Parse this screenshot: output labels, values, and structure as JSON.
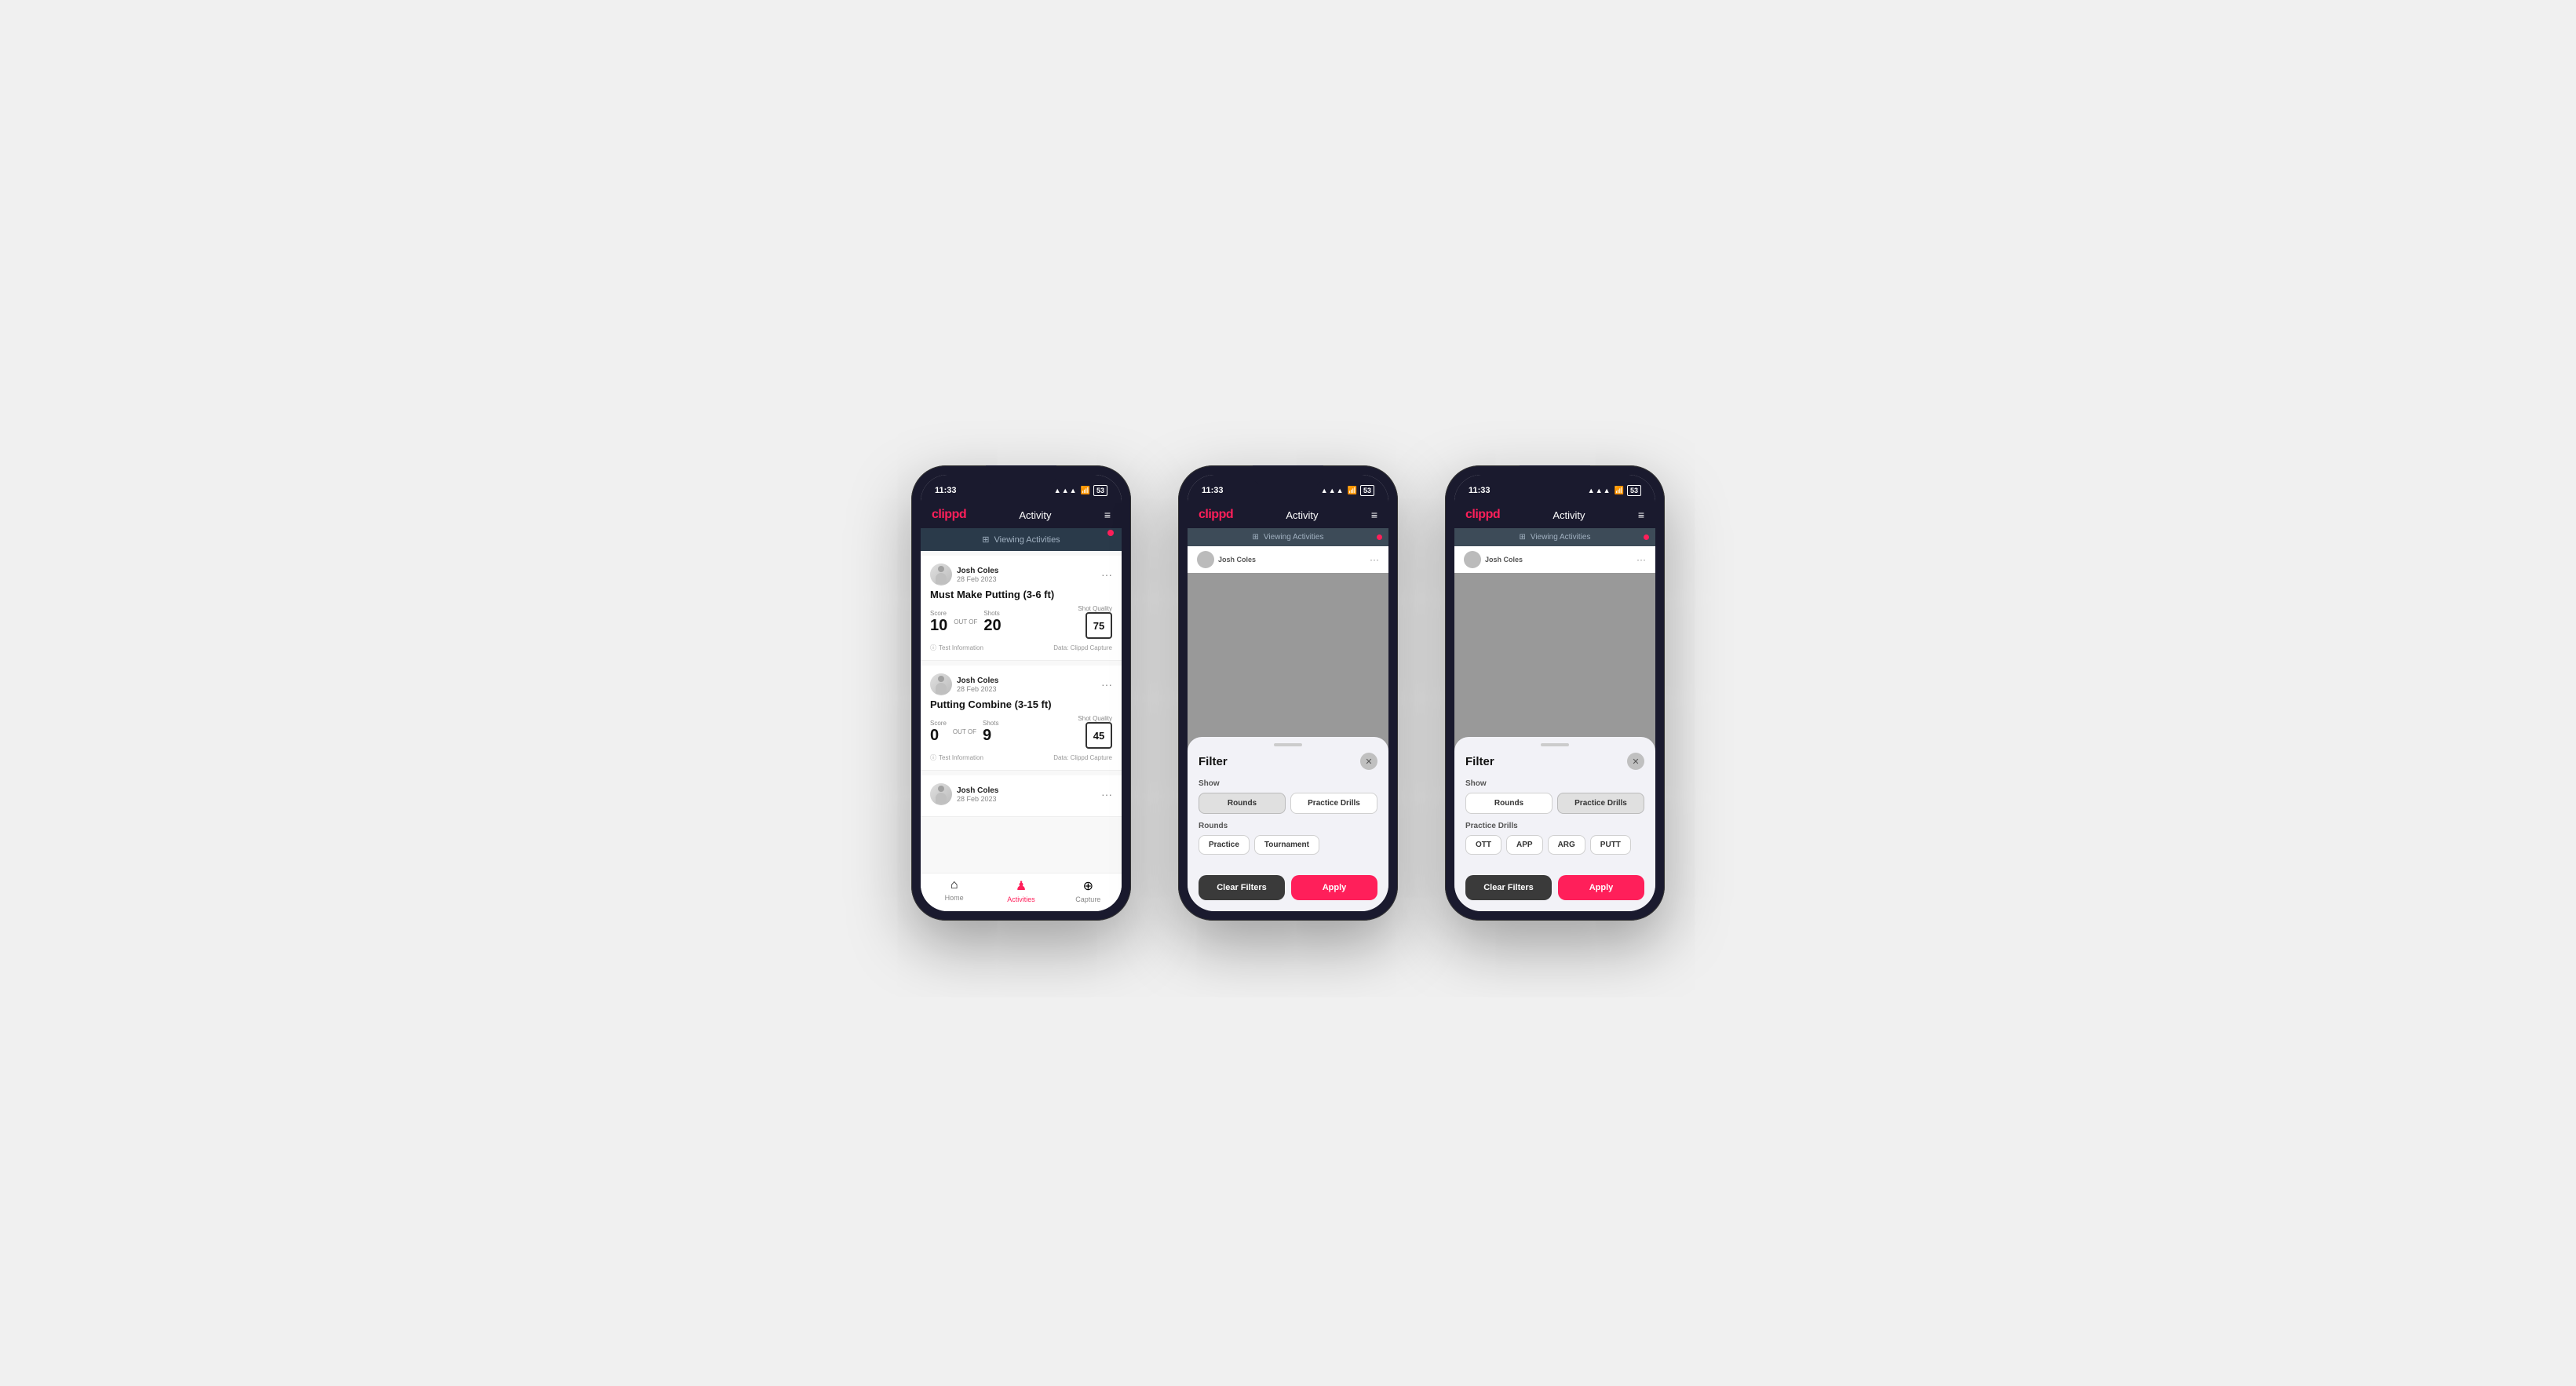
{
  "app": {
    "logo": "clippd",
    "header_title": "Activity",
    "menu_icon": "≡"
  },
  "status_bar": {
    "time": "11:33",
    "signal": "▲▲▲",
    "wifi": "WiFi",
    "battery": "53"
  },
  "viewing_banner": {
    "text": "Viewing Activities",
    "icon": "⊞"
  },
  "phone1": {
    "activities": [
      {
        "user_name": "Josh Coles",
        "user_date": "28 Feb 2023",
        "title": "Must Make Putting (3-6 ft)",
        "score_label": "Score",
        "score_value": "10",
        "out_of_label": "OUT OF",
        "shots_label": "Shots",
        "shots_value": "20",
        "shot_quality_label": "Shot Quality",
        "shot_quality_value": "75",
        "footer_left": "Test Information",
        "footer_right": "Data: Clippd Capture"
      },
      {
        "user_name": "Josh Coles",
        "user_date": "28 Feb 2023",
        "title": "Putting Combine (3-15 ft)",
        "score_label": "Score",
        "score_value": "0",
        "out_of_label": "OUT OF",
        "shots_label": "Shots",
        "shots_value": "9",
        "shot_quality_label": "Shot Quality",
        "shot_quality_value": "45",
        "footer_left": "Test Information",
        "footer_right": "Data: Clippd Capture"
      },
      {
        "user_name": "Josh Coles",
        "user_date": "28 Feb 2023",
        "title": "",
        "score_label": "",
        "score_value": "",
        "out_of_label": "",
        "shots_label": "",
        "shots_value": "",
        "shot_quality_label": "",
        "shot_quality_value": "",
        "footer_left": "",
        "footer_right": ""
      }
    ],
    "bottom_nav": [
      {
        "label": "Home",
        "icon": "⌂",
        "active": false
      },
      {
        "label": "Activities",
        "icon": "♟",
        "active": true
      },
      {
        "label": "Capture",
        "icon": "⊕",
        "active": false
      }
    ]
  },
  "phone2": {
    "filter": {
      "title": "Filter",
      "show_label": "Show",
      "show_options": [
        {
          "label": "Rounds",
          "active": true
        },
        {
          "label": "Practice Drills",
          "active": false
        }
      ],
      "rounds_label": "Rounds",
      "round_options": [
        {
          "label": "Practice",
          "active": false
        },
        {
          "label": "Tournament",
          "active": false
        }
      ],
      "clear_label": "Clear Filters",
      "apply_label": "Apply"
    }
  },
  "phone3": {
    "filter": {
      "title": "Filter",
      "show_label": "Show",
      "show_options": [
        {
          "label": "Rounds",
          "active": false
        },
        {
          "label": "Practice Drills",
          "active": true
        }
      ],
      "drills_label": "Practice Drills",
      "drill_options": [
        {
          "label": "OTT",
          "active": false
        },
        {
          "label": "APP",
          "active": false
        },
        {
          "label": "ARG",
          "active": false
        },
        {
          "label": "PUTT",
          "active": false
        }
      ],
      "clear_label": "Clear Filters",
      "apply_label": "Apply"
    }
  }
}
